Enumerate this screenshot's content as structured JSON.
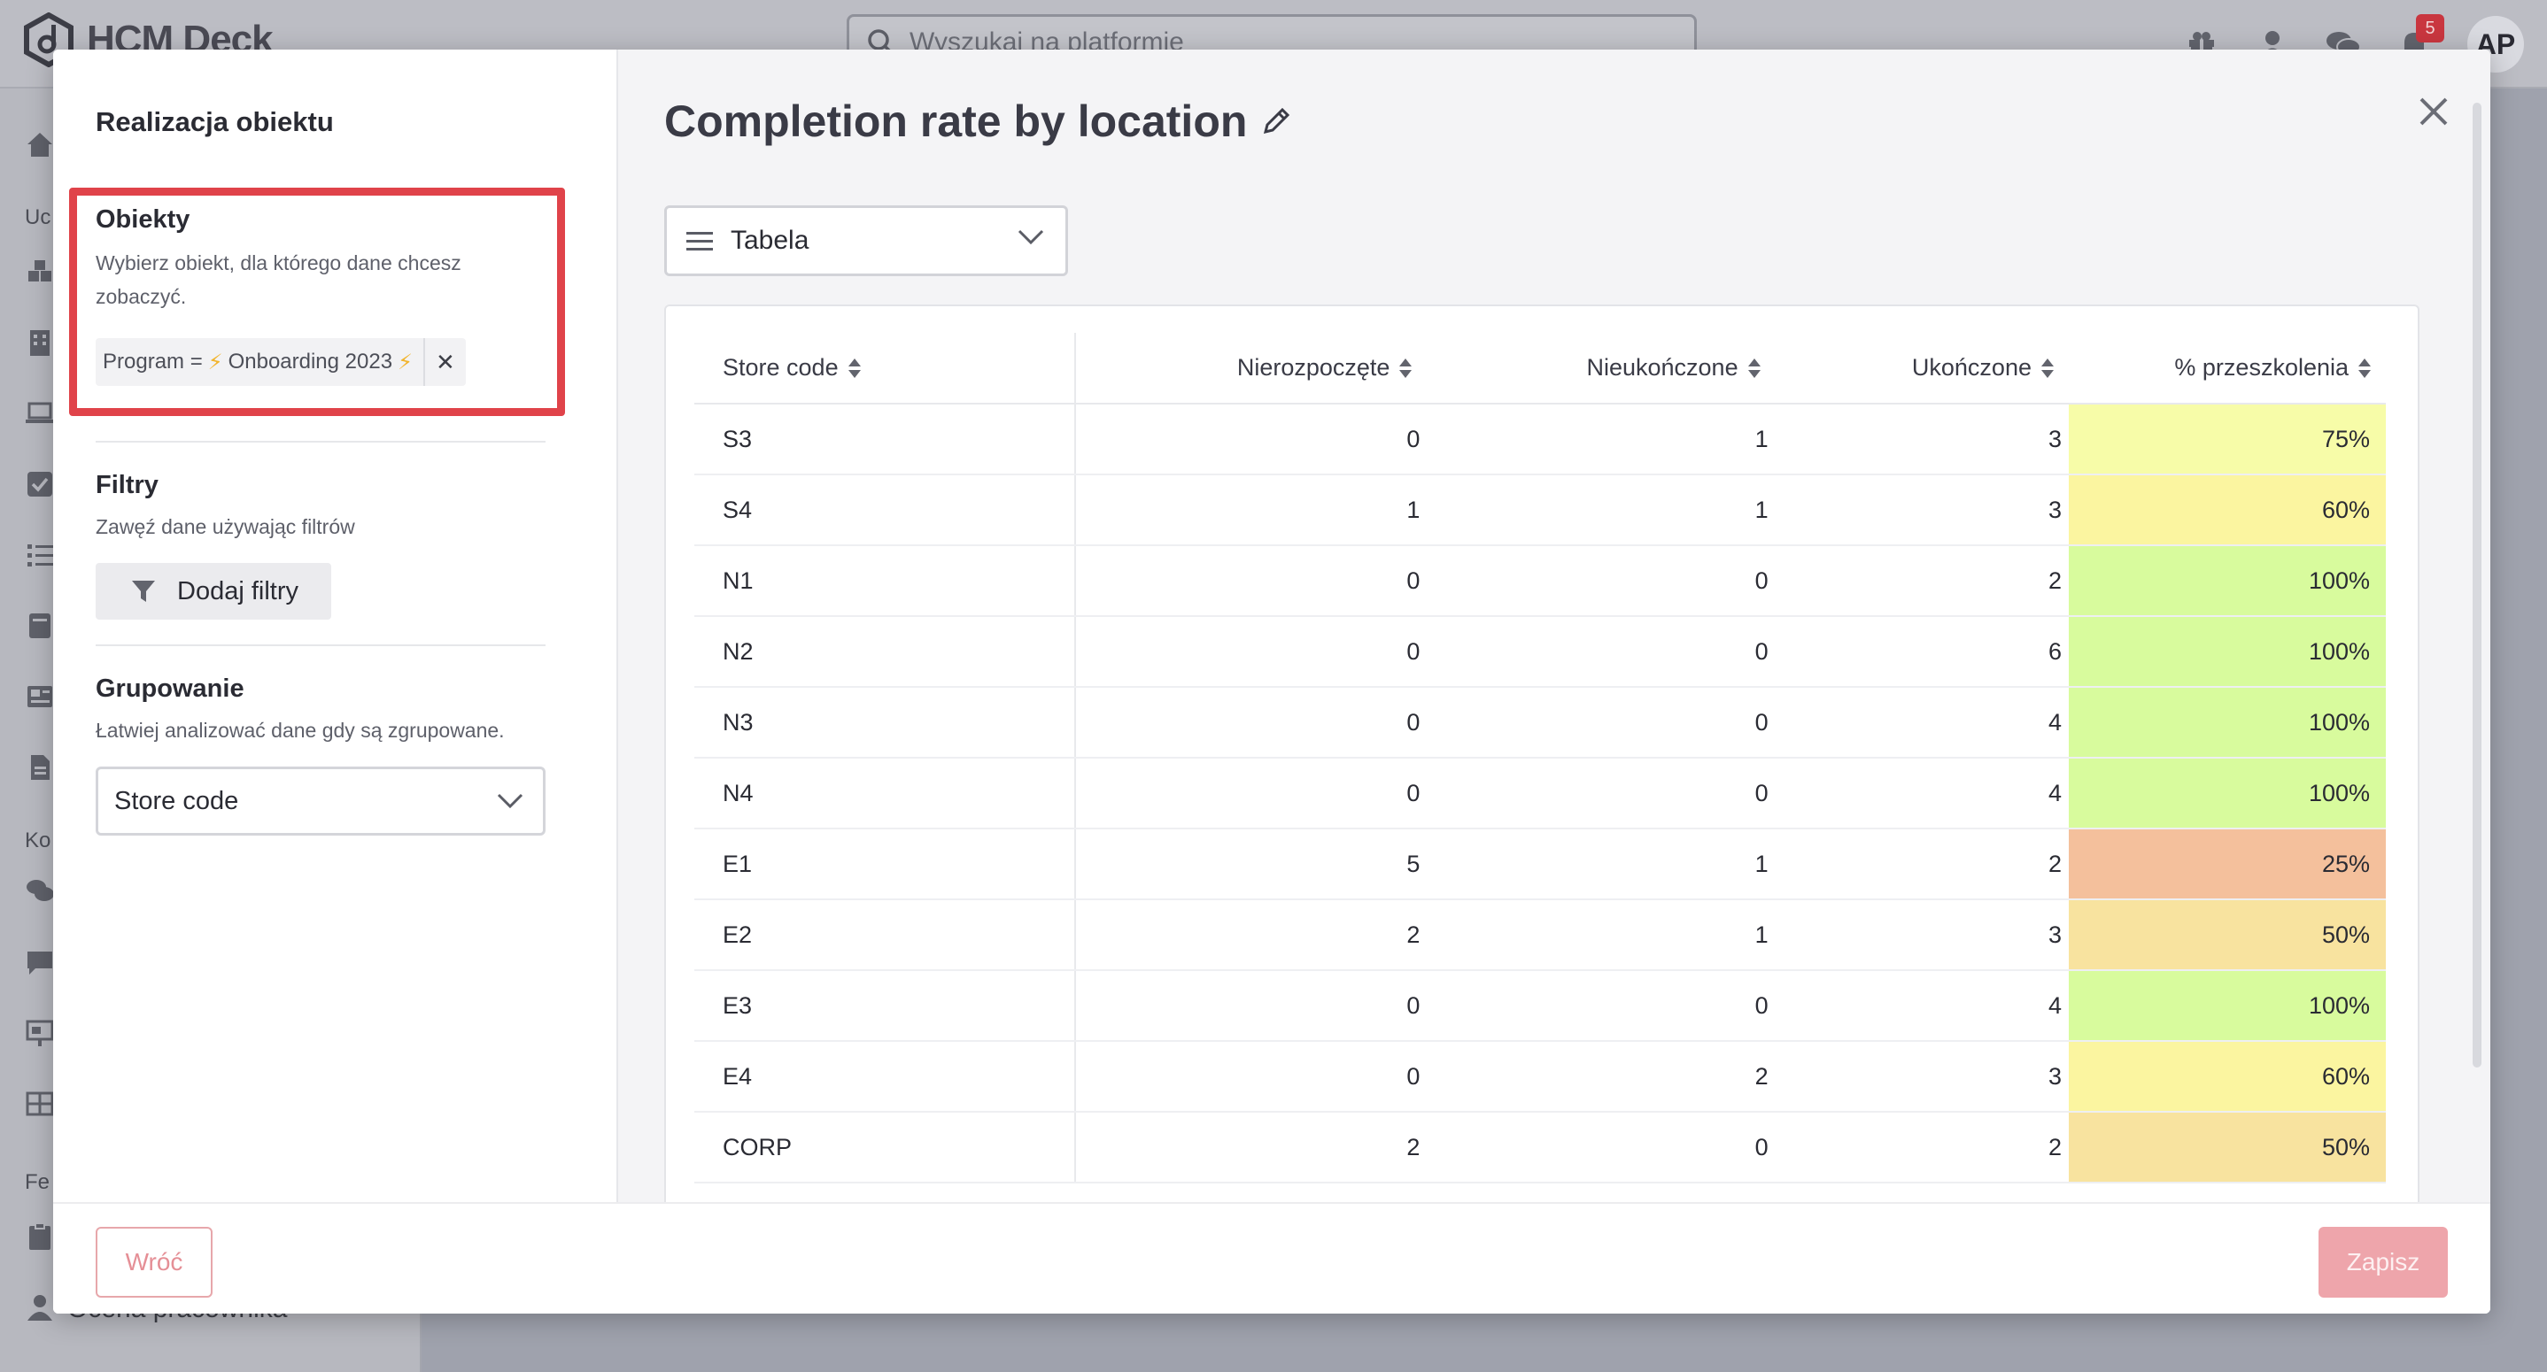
{
  "app": {
    "logo_text": "HCM Deck",
    "search_placeholder": "Wyszukaj na platformie",
    "notifications_count": "5",
    "avatar_initials": "AP",
    "sidebar_sections": [
      "Uc",
      "Ko",
      "Fe"
    ],
    "sidebar_bottom_text": "Ocena pracownika"
  },
  "modal": {
    "left": {
      "title": "Realizacja obiektu",
      "objects": {
        "title": "Obiekty",
        "description_line1": "Wybierz obiekt, dla którego dane chcesz",
        "description_line2": "zobaczyć.",
        "chip_prefix": "Program =",
        "chip_value": "Onboarding 2023"
      },
      "filters": {
        "title": "Filtry",
        "description": "Zawęź dane używając filtrów",
        "add_button": "Dodaj filtry"
      },
      "grouping": {
        "title": "Grupowanie",
        "description": "Łatwiej analizować dane gdy są zgrupowane.",
        "selected": "Store code"
      }
    },
    "right": {
      "title": "Completion rate by location",
      "view_selected": "Tabela",
      "table": {
        "headers": [
          "Store code",
          "Nierozpoczęte",
          "Nieukończone",
          "Ukończone",
          "% przeszkolenia"
        ],
        "rows": [
          {
            "code": "S3",
            "not_started": "0",
            "unfinished": "1",
            "completed": "3",
            "pct": "75%",
            "color": "#f7fca8"
          },
          {
            "code": "S4",
            "not_started": "1",
            "unfinished": "1",
            "completed": "3",
            "pct": "60%",
            "color": "#fbf5a0"
          },
          {
            "code": "N1",
            "not_started": "0",
            "unfinished": "0",
            "completed": "2",
            "pct": "100%",
            "color": "#d8fb9d"
          },
          {
            "code": "N2",
            "not_started": "0",
            "unfinished": "0",
            "completed": "6",
            "pct": "100%",
            "color": "#d8fb9d"
          },
          {
            "code": "N3",
            "not_started": "0",
            "unfinished": "0",
            "completed": "4",
            "pct": "100%",
            "color": "#d8fb9d"
          },
          {
            "code": "N4",
            "not_started": "0",
            "unfinished": "0",
            "completed": "4",
            "pct": "100%",
            "color": "#d8fb9d"
          },
          {
            "code": "E1",
            "not_started": "5",
            "unfinished": "1",
            "completed": "2",
            "pct": "25%",
            "color": "#f4c09c"
          },
          {
            "code": "E2",
            "not_started": "2",
            "unfinished": "1",
            "completed": "3",
            "pct": "50%",
            "color": "#f8e39f"
          },
          {
            "code": "E3",
            "not_started": "0",
            "unfinished": "0",
            "completed": "4",
            "pct": "100%",
            "color": "#d8fb9d"
          },
          {
            "code": "E4",
            "not_started": "0",
            "unfinished": "2",
            "completed": "3",
            "pct": "60%",
            "color": "#fbf5a0"
          },
          {
            "code": "CORP",
            "not_started": "2",
            "unfinished": "0",
            "completed": "2",
            "pct": "50%",
            "color": "#f8e39f"
          }
        ]
      }
    },
    "footer": {
      "back_label": "Wróć",
      "save_label": "Zapisz"
    }
  }
}
